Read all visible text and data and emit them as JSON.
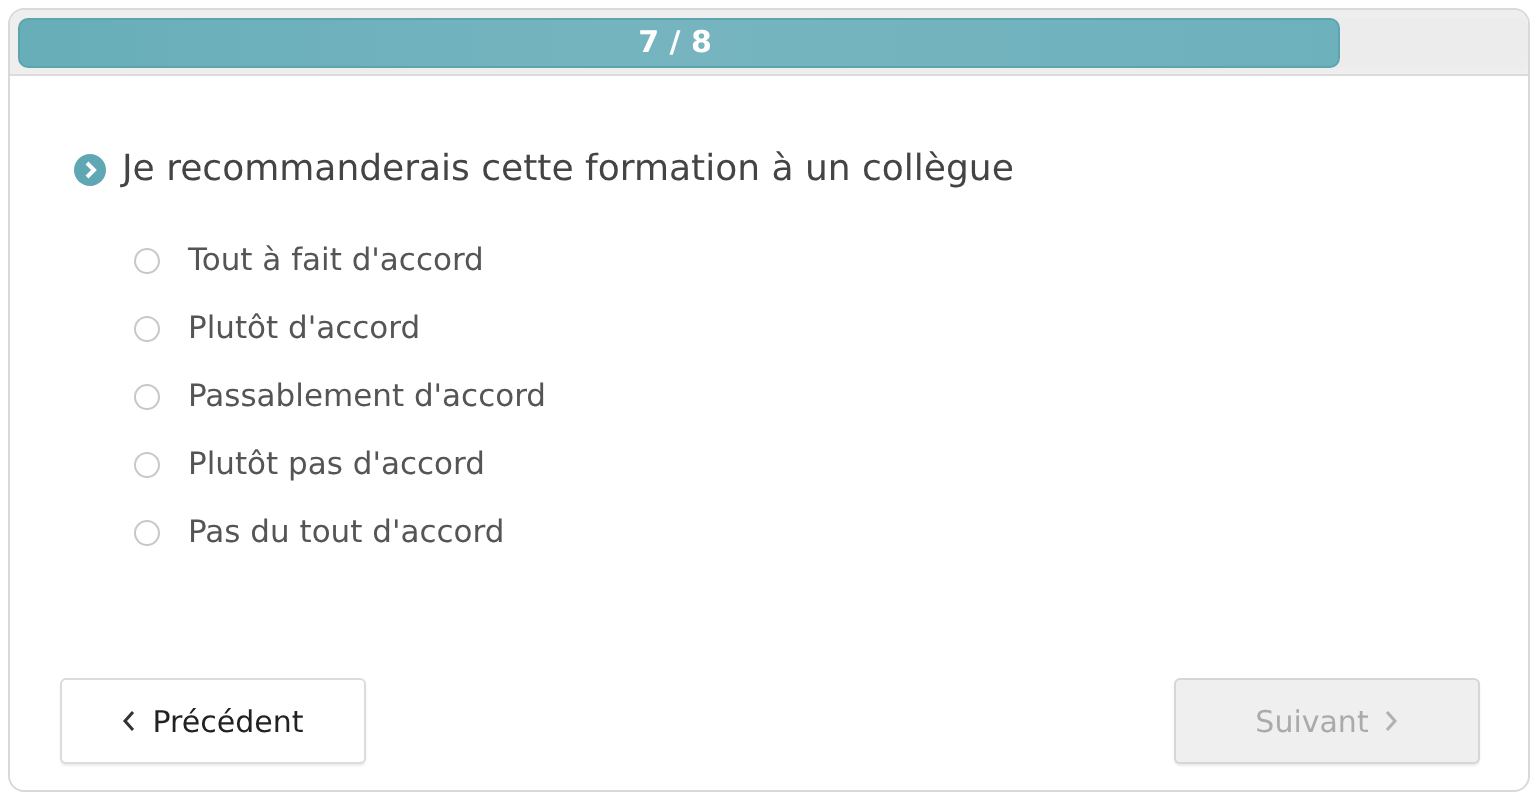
{
  "progress": {
    "label": "7 / 8",
    "level": 0.875
  },
  "question": "Je recommanderais cette formation à un collègue",
  "options": [
    {
      "label": "Tout à fait d'accord",
      "selected": false
    },
    {
      "label": "Plutôt d'accord",
      "selected": false
    },
    {
      "label": "Passablement d'accord",
      "selected": false
    },
    {
      "label": "Plutôt pas d'accord",
      "selected": false
    },
    {
      "label": "Pas du tout d'accord",
      "selected": false
    }
  ],
  "buttons": [
    {
      "kind": "previous",
      "label": "Précédent",
      "disabled": false
    },
    {
      "kind": "next",
      "label": "Suivant",
      "disabled": true
    }
  ]
}
